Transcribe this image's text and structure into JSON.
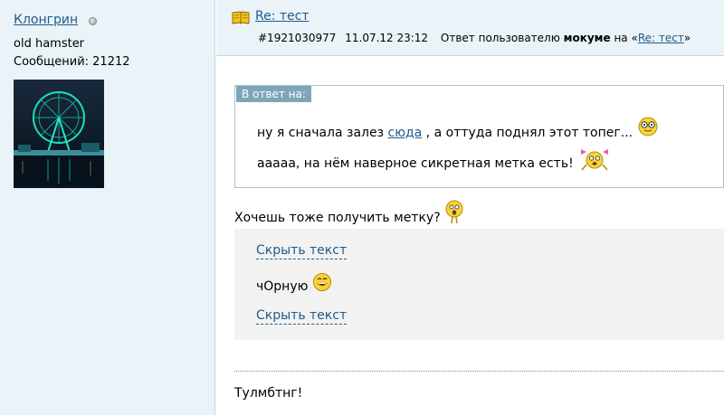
{
  "author": {
    "name": "Клонгрин",
    "title": "old hamster",
    "posts": "Сообщений: 21212"
  },
  "post": {
    "title": "Re: тест",
    "id": "#1921030977",
    "timestamp": "11.07.12 23:12",
    "reply_prefix": "Ответ пользователю",
    "reply_user": "мокуме",
    "reply_on": "на «",
    "reply_link": "Re: тест",
    "reply_close": "»"
  },
  "quote": {
    "label": "В ответ на:",
    "line1_before": "ну я сначала залез",
    "line1_link": "сюда",
    "line1_after": ", а оттуда поднял этот топег...",
    "line2": "ааааа, на нём наверное сикретная метка есть!"
  },
  "body": {
    "line1": "Хочешь тоже получить метку?",
    "spoiler_toggle_top": "Скрыть текст",
    "spoiler_text": "чОрную",
    "spoiler_toggle_bottom": "Скрыть текст",
    "signature": "Тулмбтнг!"
  },
  "colors": {
    "link": "#1e5b8c",
    "panel_bg": "#eaf3f7",
    "quote_label_bg": "#7fa5b8",
    "spoiler_bg": "#f2f2f2"
  },
  "icons": [
    "status-offline-icon",
    "book-icon",
    "smiley-glasses-icon",
    "smiley-bow-icon",
    "smiley-thinking-icon",
    "smiley-grin-icon"
  ]
}
